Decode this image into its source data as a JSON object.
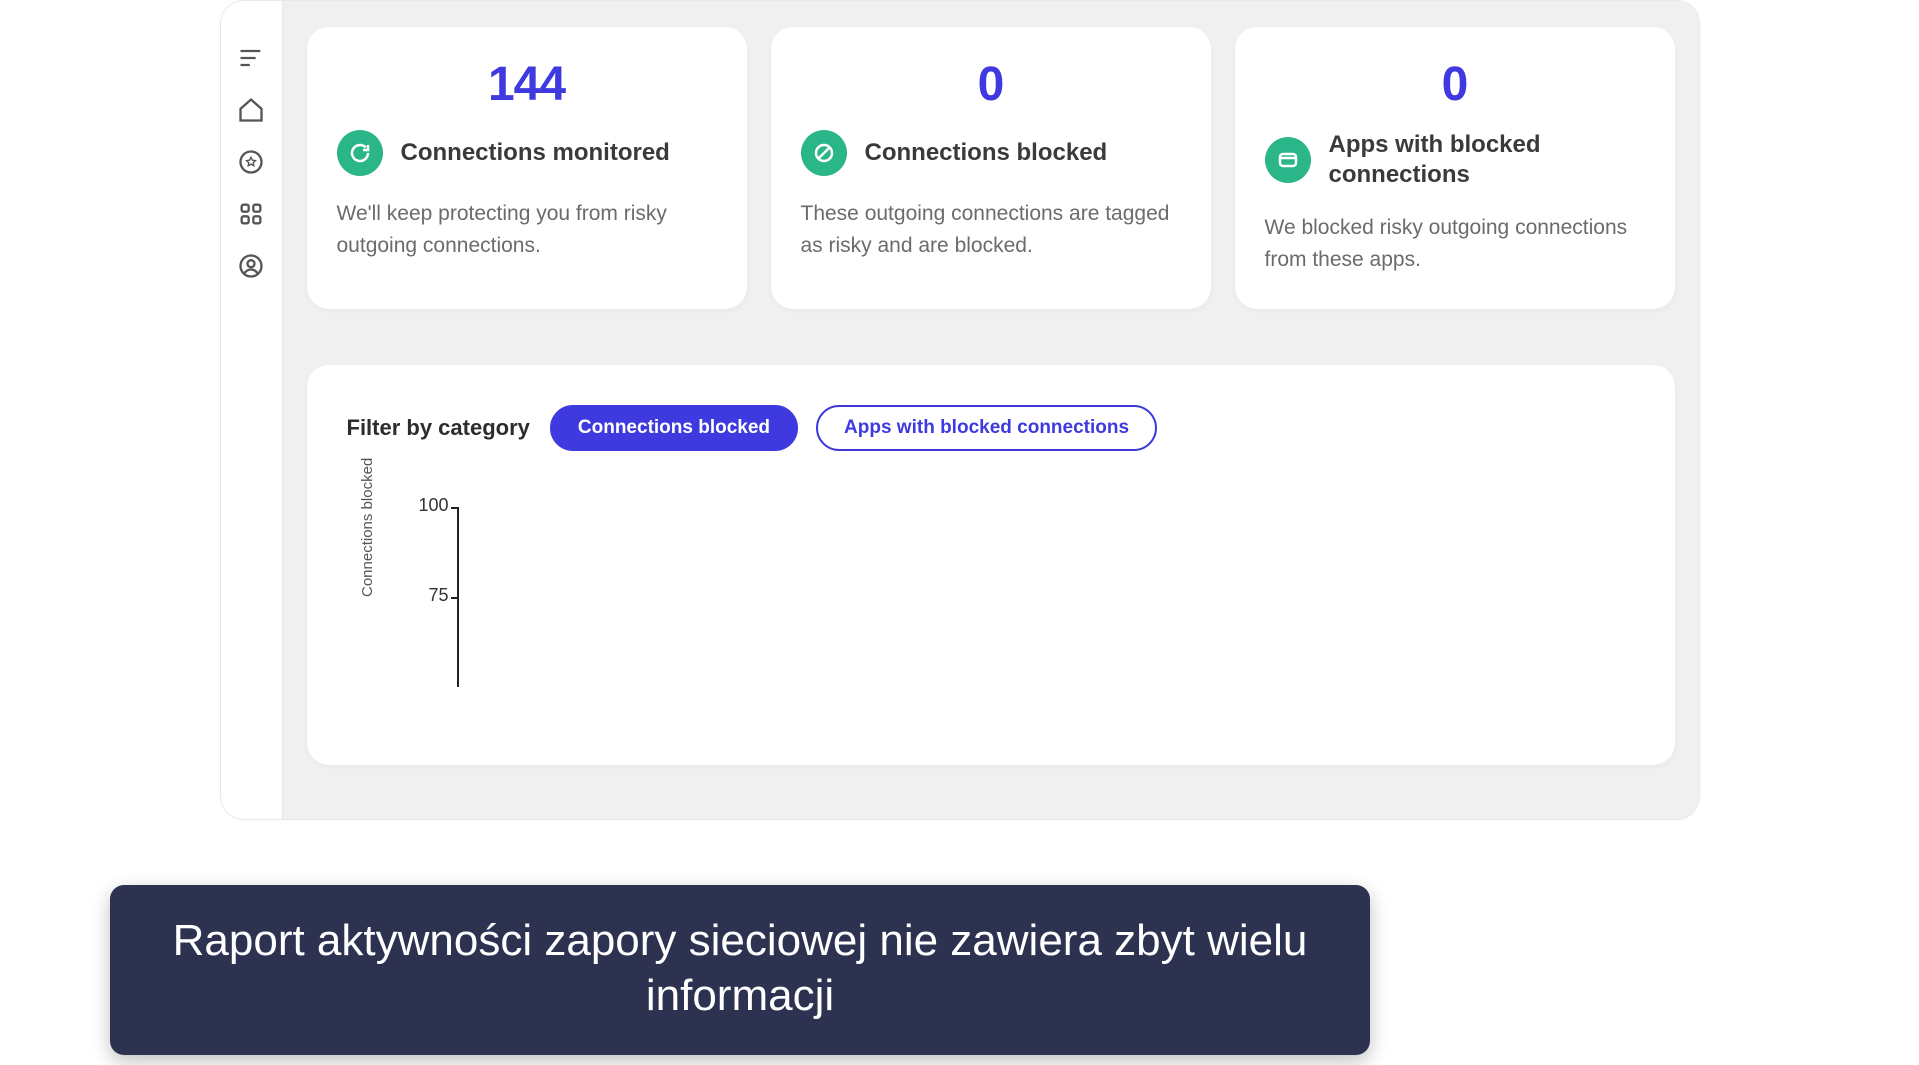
{
  "sidebar": {
    "items": [
      {
        "name": "menu"
      },
      {
        "name": "home"
      },
      {
        "name": "shield"
      },
      {
        "name": "apps"
      },
      {
        "name": "profile"
      }
    ]
  },
  "cards": [
    {
      "value": "144",
      "icon": "refresh-icon",
      "title": "Connections monitored",
      "desc": "We'll keep protecting you from risky outgoing connections."
    },
    {
      "value": "0",
      "icon": "blocked-icon",
      "title": "Connections blocked",
      "desc": "These outgoing connections are tagged as risky and are blocked."
    },
    {
      "value": "0",
      "icon": "app-icon",
      "title": "Apps with blocked connections",
      "desc": "We blocked risky outgoing connections from these apps."
    }
  ],
  "filter": {
    "label": "Filter by category",
    "options": [
      {
        "label": "Connections blocked",
        "active": true
      },
      {
        "label": "Apps with blocked connections",
        "active": false
      }
    ]
  },
  "chart_data": {
    "type": "line",
    "title": "",
    "xlabel": "",
    "ylabel": "Connections blocked",
    "ylim": [
      0,
      100
    ],
    "yticks": [
      75,
      100
    ],
    "categories": [],
    "values": []
  },
  "caption": "Raport aktywności zapory sieciowej nie zawiera zbyt wielu informacji"
}
